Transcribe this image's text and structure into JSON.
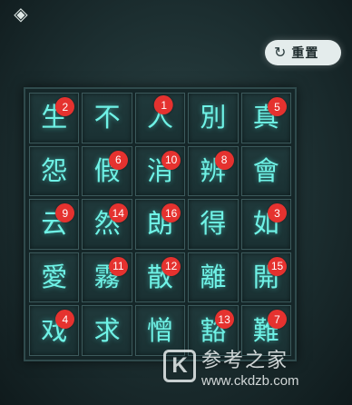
{
  "header": {
    "back_icon": "back-diamond-icon",
    "reset_label": "重置",
    "reset_icon": "refresh-icon"
  },
  "board": {
    "cells": [
      {
        "char": "生",
        "badge": "2"
      },
      {
        "char": "不",
        "badge": ""
      },
      {
        "char": "人",
        "badge": "1"
      },
      {
        "char": "別",
        "badge": ""
      },
      {
        "char": "真",
        "badge": "5"
      },
      {
        "char": "怨",
        "badge": ""
      },
      {
        "char": "假",
        "badge": "6"
      },
      {
        "char": "消",
        "badge": "10"
      },
      {
        "char": "辨",
        "badge": "8"
      },
      {
        "char": "會",
        "badge": ""
      },
      {
        "char": "云",
        "badge": "9"
      },
      {
        "char": "然",
        "badge": "14"
      },
      {
        "char": "朗",
        "badge": "16"
      },
      {
        "char": "得",
        "badge": ""
      },
      {
        "char": "如",
        "badge": "3"
      },
      {
        "char": "愛",
        "badge": ""
      },
      {
        "char": "霧",
        "badge": "11"
      },
      {
        "char": "散",
        "badge": "12"
      },
      {
        "char": "離",
        "badge": ""
      },
      {
        "char": "開",
        "badge": "15"
      },
      {
        "char": "戏",
        "badge": "4"
      },
      {
        "char": "求",
        "badge": ""
      },
      {
        "char": "憎",
        "badge": ""
      },
      {
        "char": "豁",
        "badge": "13"
      },
      {
        "char": "難",
        "badge": "7"
      }
    ]
  },
  "watermark": {
    "logo_letter": "K",
    "name": "参考之家",
    "url": "www.ckdzb.com"
  },
  "colors": {
    "glyph": "#6ff2e6",
    "badge": "#e5322f",
    "background": "#1c2e30"
  }
}
